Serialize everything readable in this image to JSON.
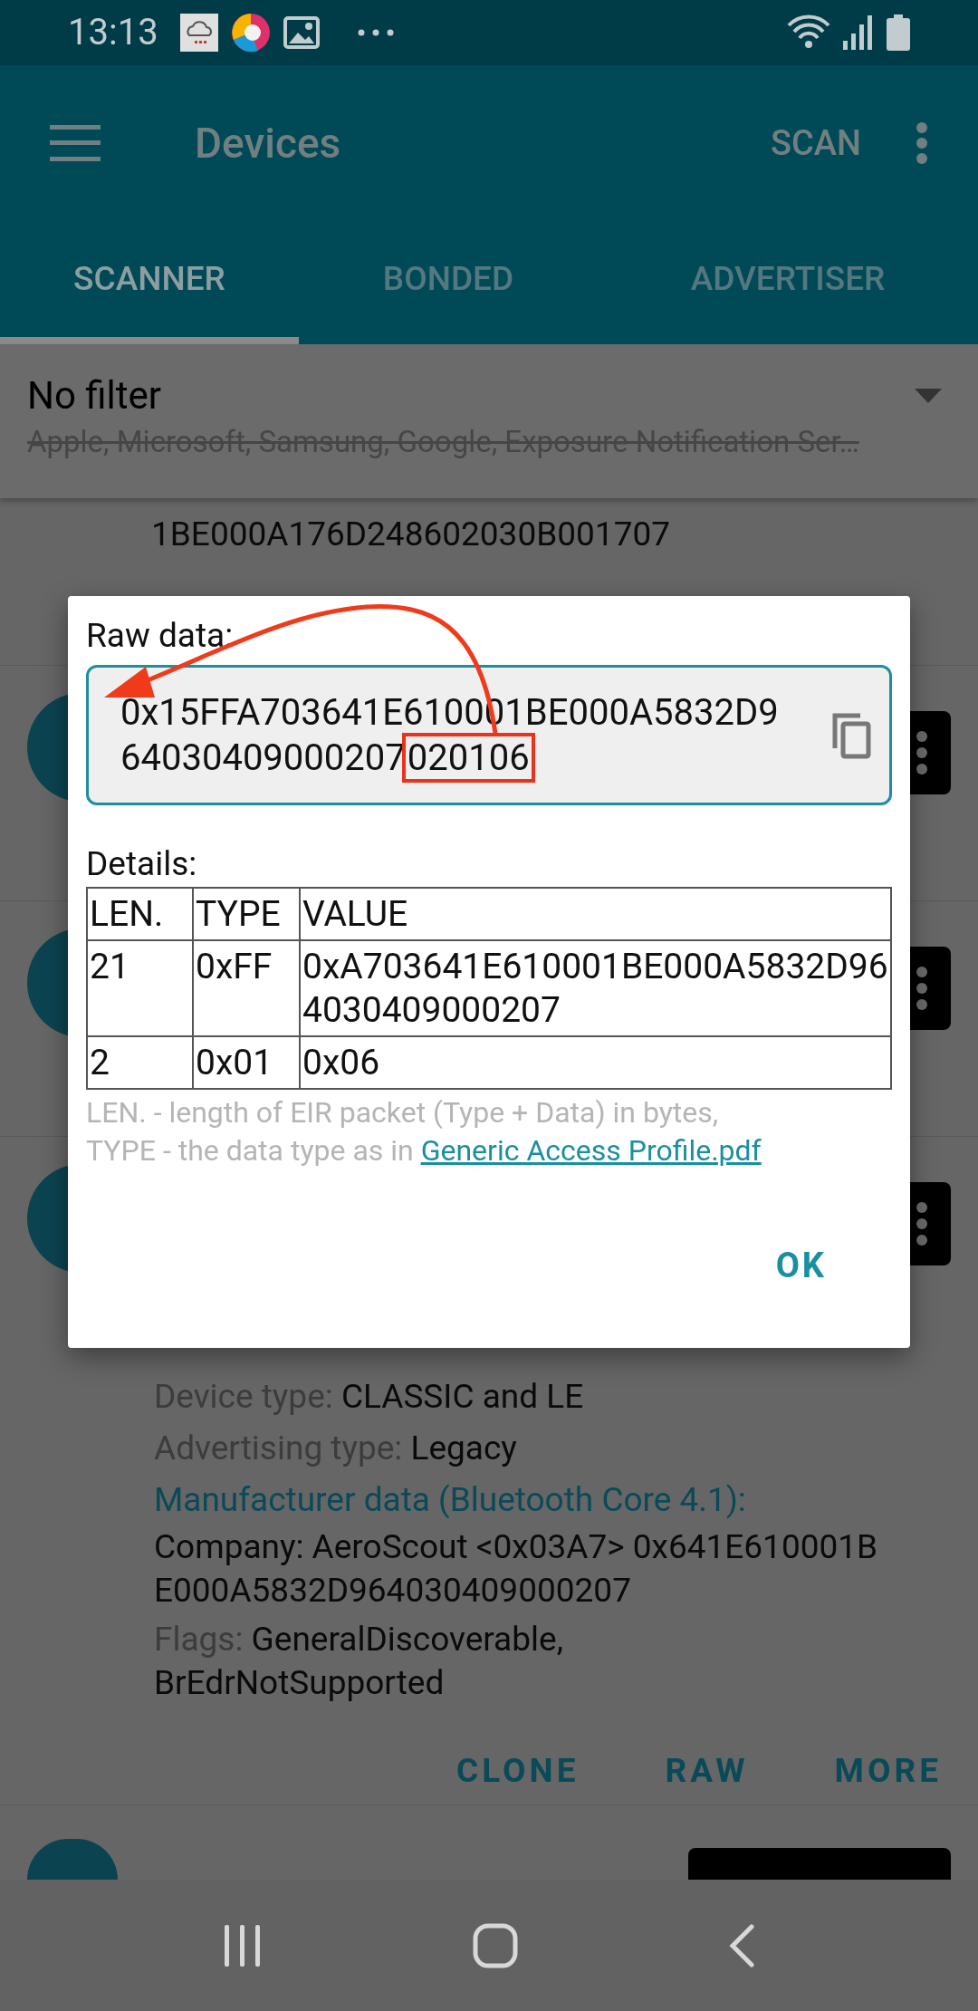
{
  "status_bar": {
    "time": "13:13"
  },
  "app_bar": {
    "title": "Devices",
    "action": "SCAN"
  },
  "tabs": [
    {
      "label": "SCANNER",
      "selected": true
    },
    {
      "label": "BONDED",
      "selected": false
    },
    {
      "label": "ADVERTISER",
      "selected": false
    }
  ],
  "filter": {
    "title": "No filter",
    "subtitle": "Apple, Microsoft, Samsung, Google, Exposure Notification Ser…",
    "struck": true
  },
  "list": {
    "partial_text": "1BE000A176D248602030B001707",
    "details": [
      {
        "label": "Device type:",
        "value": "CLASSIC and LE"
      },
      {
        "label": "Advertising type:",
        "value": "Legacy"
      }
    ],
    "manufacturer_title": "Manufacturer data (Bluetooth Core 4.1):",
    "manufacturer_value": "Company: AeroScout <0x03A7> 0x641E610001BE000A5832D964030409000207",
    "flags": {
      "label": "Flags:",
      "value": "GeneralDiscoverable, BrEdrNotSupported"
    },
    "actions": [
      "CLONE",
      "RAW",
      "MORE"
    ]
  },
  "dialog": {
    "raw_label": "Raw data:",
    "raw_parts": [
      {
        "text": "0x15FFA703641E610001BE000A5832D964030409000207",
        "highlighted": false
      },
      {
        "text": "020106",
        "highlighted": true
      }
    ],
    "details_label": "Details:",
    "table": {
      "columns": [
        "LEN.",
        "TYPE",
        "VALUE"
      ],
      "rows": [
        [
          "21",
          "0xFF",
          "0xA703641E610001BE000A5832D964030409000207"
        ],
        [
          "2",
          "0x01",
          "0x06"
        ]
      ]
    },
    "note_lines": [
      "LEN. - length of EIR packet (Type + Data) in bytes,",
      "TYPE - the data type as in"
    ],
    "link": "Generic Access Profile.pdf",
    "ok": "OK"
  }
}
